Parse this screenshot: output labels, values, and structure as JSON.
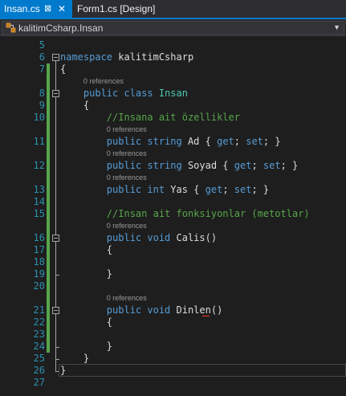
{
  "tabs": [
    {
      "label": "Insan.cs",
      "active": true,
      "pin_icon": "pin-icon",
      "close_icon": "close-icon"
    },
    {
      "label": "Form1.cs [Design]",
      "active": false
    }
  ],
  "navbar": {
    "label": "kalitimCsharp.Insan",
    "icon": "class-icon"
  },
  "colors": {
    "keyword": "#569cd6",
    "type": "#4ec9b0",
    "comment": "#57a64a",
    "line_number": "#2b91af",
    "accent": "#007acc"
  },
  "lines": [
    {
      "n": "5",
      "tokens": []
    },
    {
      "n": "6",
      "tokens": [
        {
          "t": "namespace",
          "c": "kw"
        },
        {
          "t": " kalitimCsharp",
          "c": "id"
        }
      ]
    },
    {
      "n": "7",
      "tokens": [
        {
          "t": "{",
          "c": "id"
        }
      ]
    },
    {
      "n": "8",
      "lens": "0 references",
      "tokens": [
        {
          "t": "    public",
          "c": "kw"
        },
        {
          "t": " class",
          "c": "kw"
        },
        {
          "t": " Insan",
          "c": "cls"
        }
      ]
    },
    {
      "n": "9",
      "tokens": [
        {
          "t": "    {",
          "c": "id"
        }
      ]
    },
    {
      "n": "10",
      "tokens": [
        {
          "t": "        //Insana ait özellikler",
          "c": "cm"
        }
      ]
    },
    {
      "n": "11",
      "lens": "0 references",
      "tokens": [
        {
          "t": "        public",
          "c": "kw"
        },
        {
          "t": " string",
          "c": "kw"
        },
        {
          "t": " Ad { ",
          "c": "id"
        },
        {
          "t": "get",
          "c": "kw"
        },
        {
          "t": "; ",
          "c": "id"
        },
        {
          "t": "set",
          "c": "kw"
        },
        {
          "t": "; }",
          "c": "id"
        }
      ]
    },
    {
      "n": "12",
      "lens": "0 references",
      "tokens": [
        {
          "t": "        public",
          "c": "kw"
        },
        {
          "t": " string",
          "c": "kw"
        },
        {
          "t": " Soyad { ",
          "c": "id"
        },
        {
          "t": "get",
          "c": "kw"
        },
        {
          "t": "; ",
          "c": "id"
        },
        {
          "t": "set",
          "c": "kw"
        },
        {
          "t": "; }",
          "c": "id"
        }
      ]
    },
    {
      "n": "13",
      "lens": "0 references",
      "tokens": [
        {
          "t": "        public",
          "c": "kw"
        },
        {
          "t": " int",
          "c": "kw"
        },
        {
          "t": " Yas { ",
          "c": "id"
        },
        {
          "t": "get",
          "c": "kw"
        },
        {
          "t": "; ",
          "c": "id"
        },
        {
          "t": "set",
          "c": "kw"
        },
        {
          "t": "; }",
          "c": "id"
        }
      ]
    },
    {
      "n": "14",
      "tokens": []
    },
    {
      "n": "15",
      "tokens": [
        {
          "t": "        //Insan ait fonksiyonlar (metotlar)",
          "c": "cm"
        }
      ]
    },
    {
      "n": "16",
      "lens": "0 references",
      "tokens": [
        {
          "t": "        public",
          "c": "kw"
        },
        {
          "t": " void",
          "c": "kw"
        },
        {
          "t": " Calis()",
          "c": "id"
        }
      ]
    },
    {
      "n": "17",
      "tokens": [
        {
          "t": "        {",
          "c": "id"
        }
      ]
    },
    {
      "n": "18",
      "tokens": []
    },
    {
      "n": "19",
      "tokens": [
        {
          "t": "        }",
          "c": "id"
        }
      ]
    },
    {
      "n": "20",
      "tokens": []
    },
    {
      "n": "21",
      "lens": "0 references",
      "tokens": [
        {
          "t": "        public",
          "c": "kw"
        },
        {
          "t": " void",
          "c": "kw"
        },
        {
          "t": " Dinlen()",
          "c": "id"
        }
      ]
    },
    {
      "n": "22",
      "tokens": [
        {
          "t": "        {",
          "c": "id"
        }
      ]
    },
    {
      "n": "23",
      "tokens": []
    },
    {
      "n": "24",
      "tokens": [
        {
          "t": "        }",
          "c": "id"
        }
      ]
    },
    {
      "n": "25",
      "tokens": [
        {
          "t": "    }",
          "c": "id"
        }
      ]
    },
    {
      "n": "26",
      "tokens": [
        {
          "t": "}",
          "c": "id"
        }
      ]
    },
    {
      "n": "27",
      "tokens": []
    }
  ]
}
